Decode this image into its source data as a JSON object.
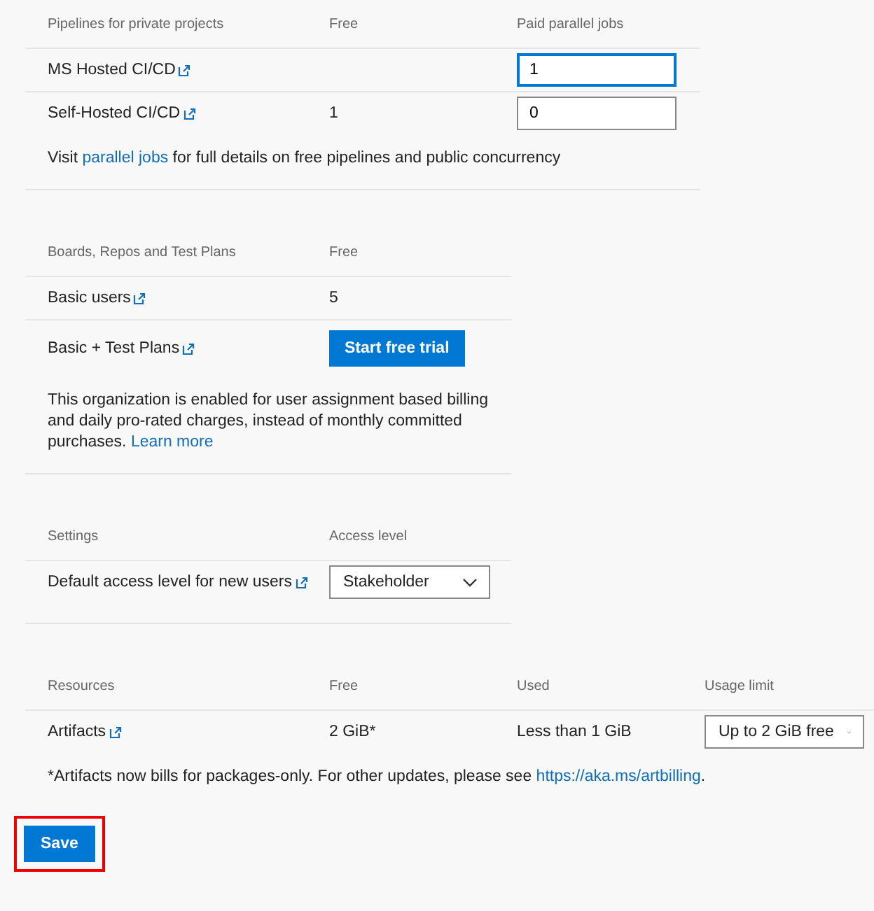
{
  "sections": [
    {
      "kind": "pipelines",
      "columns": [
        "Pipelines for private projects",
        "Free",
        "Paid parallel jobs"
      ],
      "rows": [
        [
          {
            "kind": "link-label",
            "text": "MS Hosted CI/CD"
          },
          {
            "kind": "text",
            "text": ""
          },
          {
            "kind": "input",
            "value": "1",
            "focused": true
          }
        ],
        [
          {
            "kind": "link-label",
            "text": "Self-Hosted CI/CD"
          },
          {
            "kind": "text",
            "text": "1"
          },
          {
            "kind": "input",
            "value": "0",
            "focused": false
          }
        ]
      ],
      "note": [
        {
          "kind": "text",
          "text": "Visit "
        },
        {
          "kind": "link",
          "text": "parallel jobs"
        },
        {
          "kind": "text",
          "text": " for full details on free pipelines and public concurrency"
        }
      ]
    },
    {
      "kind": "boards",
      "columns": [
        "Boards, Repos and Test Plans",
        "Free"
      ],
      "rows": [
        [
          {
            "kind": "link-label",
            "text": "Basic users"
          },
          {
            "kind": "text",
            "text": "5"
          }
        ],
        [
          {
            "kind": "link-label",
            "text": "Basic + Test Plans"
          },
          {
            "kind": "button",
            "text": "Start free trial"
          }
        ]
      ],
      "note": [
        {
          "kind": "text",
          "text": "This organization is enabled for user assignment based billing and daily pro-rated charges, instead of monthly committed purchases. "
        },
        {
          "kind": "link",
          "text": "Learn more"
        }
      ]
    },
    {
      "kind": "settings",
      "columns": [
        "Settings",
        "Access level"
      ],
      "rows": [
        [
          {
            "kind": "link-label",
            "text": "Default access level for new users"
          },
          {
            "kind": "select",
            "value": "Stakeholder"
          }
        ]
      ]
    },
    {
      "kind": "resources",
      "columns": [
        "Resources",
        "Free",
        "Used",
        "Usage limit"
      ],
      "rows": [
        [
          {
            "kind": "link-label",
            "text": "Artifacts"
          },
          {
            "kind": "text",
            "text": "2 GiB*"
          },
          {
            "kind": "text",
            "text": "Less than 1 GiB"
          },
          {
            "kind": "select",
            "value": "Up to 2 GiB free"
          }
        ]
      ],
      "note": [
        {
          "kind": "text",
          "text": "*Artifacts now bills for packages-only. For other updates, please see "
        },
        {
          "kind": "link",
          "text": "https://aka.ms/artbilling"
        },
        {
          "kind": "text",
          "text": "."
        }
      ]
    }
  ],
  "save": {
    "label": "Save",
    "highlighted": true
  }
}
